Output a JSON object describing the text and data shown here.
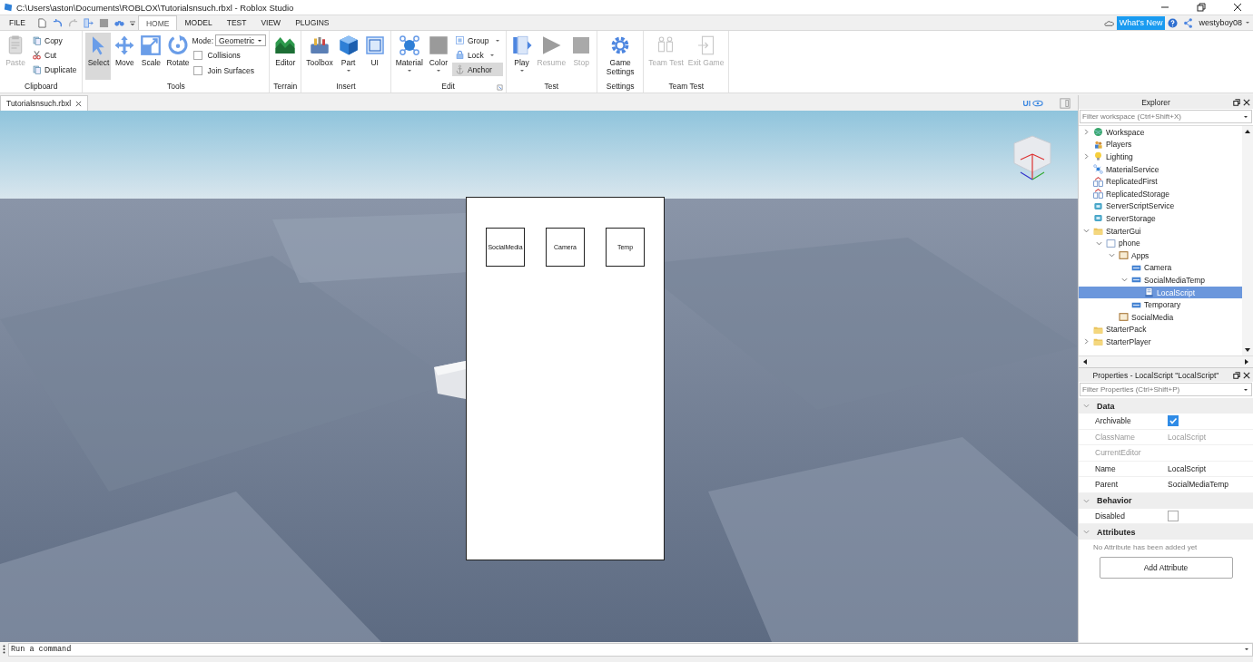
{
  "window": {
    "title": "C:\\Users\\aston\\Documents\\ROBLOX\\Tutorialsnsuch.rbxl - Roblox Studio"
  },
  "file_menu": "FILE",
  "tabs": [
    {
      "label": "HOME",
      "selected": true
    },
    {
      "label": "MODEL",
      "selected": false
    },
    {
      "label": "TEST",
      "selected": false
    },
    {
      "label": "VIEW",
      "selected": false
    },
    {
      "label": "PLUGINS",
      "selected": false
    }
  ],
  "account": {
    "whats_new": "What's New",
    "user": "westyboy08"
  },
  "ribbon": [
    {
      "label": "Clipboard",
      "launcher": false,
      "tools": [
        {
          "kind": "large",
          "label": "Paste",
          "disabled": true,
          "selected": false,
          "menu": false
        },
        {
          "kind": "small",
          "label": "Copy",
          "disabled": false,
          "selected": false,
          "menu": false
        },
        {
          "kind": "small",
          "label": "Cut",
          "disabled": false,
          "selected": false,
          "menu": false
        },
        {
          "kind": "small",
          "label": "Duplicate",
          "disabled": false,
          "selected": false,
          "menu": false
        }
      ]
    },
    {
      "label": "Tools",
      "launcher": false,
      "tools": [
        {
          "kind": "large",
          "label": "Select",
          "disabled": false,
          "selected": true,
          "menu": false
        },
        {
          "kind": "large",
          "label": "Move",
          "disabled": false,
          "selected": false,
          "menu": false
        },
        {
          "kind": "large",
          "label": "Scale",
          "disabled": false,
          "selected": false,
          "menu": false
        },
        {
          "kind": "large",
          "label": "Rotate",
          "disabled": false,
          "selected": false,
          "menu": false
        },
        {
          "kind": "dropdown",
          "label": "Mode:",
          "value": "Geometric"
        },
        {
          "kind": "check",
          "label": "Collisions",
          "checked": false
        },
        {
          "kind": "check",
          "label": "Join Surfaces",
          "checked": false
        }
      ]
    },
    {
      "label": "Terrain",
      "launcher": false,
      "tools": [
        {
          "kind": "large",
          "label": "Editor",
          "disabled": false,
          "selected": false,
          "menu": false
        }
      ]
    },
    {
      "label": "Insert",
      "launcher": false,
      "tools": [
        {
          "kind": "large",
          "label": "Toolbox",
          "disabled": false,
          "selected": false,
          "menu": false
        },
        {
          "kind": "large",
          "label": "Part",
          "disabled": false,
          "selected": false,
          "menu": true
        },
        {
          "kind": "large",
          "label": "UI",
          "disabled": false,
          "selected": false,
          "menu": false
        }
      ]
    },
    {
      "label": "Edit",
      "launcher": true,
      "tools": [
        {
          "kind": "large",
          "label": "Material",
          "disabled": false,
          "selected": false,
          "menu": true
        },
        {
          "kind": "large",
          "label": "Color",
          "disabled": false,
          "selected": false,
          "menu": true
        },
        {
          "kind": "small",
          "label": "Group",
          "disabled": false,
          "selected": false,
          "menu": true
        },
        {
          "kind": "small",
          "label": "Lock",
          "disabled": false,
          "selected": false,
          "menu": true
        },
        {
          "kind": "small",
          "label": "Anchor",
          "disabled": false,
          "selected": true,
          "menu": false
        }
      ]
    },
    {
      "label": "Test",
      "launcher": false,
      "tools": [
        {
          "kind": "large",
          "label": "Play",
          "disabled": false,
          "selected": false,
          "menu": true
        },
        {
          "kind": "large",
          "label": "Resume",
          "disabled": true,
          "selected": false,
          "menu": false
        },
        {
          "kind": "large",
          "label": "Stop",
          "disabled": true,
          "selected": false,
          "menu": false
        }
      ]
    },
    {
      "label": "Settings",
      "launcher": false,
      "tools": [
        {
          "kind": "large",
          "label": "Game Settings",
          "disabled": false,
          "selected": false,
          "menu": false
        }
      ]
    },
    {
      "label": "Team Test",
      "launcher": false,
      "tools": [
        {
          "kind": "large",
          "label": "Team Test",
          "disabled": true,
          "selected": false,
          "menu": false
        },
        {
          "kind": "large",
          "label": "Exit Game",
          "disabled": true,
          "selected": false,
          "menu": false
        }
      ]
    }
  ],
  "document_tab": {
    "label": "Tutorialsnsuch.rbxl"
  },
  "view_toggle": {
    "label": "UI",
    "on": true
  },
  "viewport": {
    "gui": {
      "buttons": [
        "SocialMedia",
        "Camera",
        "Temp"
      ]
    }
  },
  "explorer": {
    "title": "Explorer",
    "filter_placeholder": "Filter workspace (Ctrl+Shift+X)",
    "items": [
      {
        "name": "Workspace",
        "kind": "globe",
        "expanded": false,
        "selected": false
      },
      {
        "name": "Players",
        "kind": "players",
        "selected": false
      },
      {
        "name": "Lighting",
        "kind": "bulb",
        "expanded": false,
        "selected": false
      },
      {
        "name": "MaterialService",
        "kind": "material",
        "selected": false
      },
      {
        "name": "ReplicatedFirst",
        "kind": "replicated",
        "selected": false
      },
      {
        "name": "ReplicatedStorage",
        "kind": "replicated",
        "selected": false
      },
      {
        "name": "ServerScriptService",
        "kind": "server",
        "selected": false
      },
      {
        "name": "ServerStorage",
        "kind": "server",
        "selected": false
      },
      {
        "name": "StarterGui",
        "kind": "folder",
        "expanded": true,
        "selected": false,
        "children": [
          {
            "name": "phone",
            "kind": "screen",
            "expanded": true,
            "selected": false,
            "children": [
              {
                "name": "Apps",
                "kind": "frame",
                "expanded": true,
                "selected": false,
                "children": [
                  {
                    "name": "Camera",
                    "kind": "button",
                    "selected": false
                  },
                  {
                    "name": "SocialMediaTemp",
                    "kind": "button",
                    "expanded": true,
                    "selected": false,
                    "children": [
                      {
                        "name": "LocalScript",
                        "kind": "script",
                        "selected": true
                      }
                    ]
                  },
                  {
                    "name": "Temporary",
                    "kind": "button",
                    "selected": false
                  }
                ]
              },
              {
                "name": "SocialMedia",
                "kind": "frame",
                "selected": false
              }
            ]
          }
        ]
      },
      {
        "name": "StarterPack",
        "kind": "folder",
        "selected": false
      },
      {
        "name": "StarterPlayer",
        "kind": "folder",
        "expanded": false,
        "selected": false
      }
    ]
  },
  "properties": {
    "title": "Properties - LocalScript \"LocalScript\"",
    "filter_placeholder": "Filter Properties (Ctrl+Shift+P)",
    "sections": [
      {
        "title": "Data",
        "expanded": true,
        "rows": [
          {
            "name": "Archivable",
            "kind": "check",
            "checked": true,
            "disabled": false
          },
          {
            "name": "ClassName",
            "kind": "text",
            "value": "LocalScript",
            "disabled": true
          },
          {
            "name": "CurrentEditor",
            "kind": "text",
            "disabled": true
          },
          {
            "name": "Name",
            "kind": "text",
            "value": "LocalScript",
            "disabled": false
          },
          {
            "name": "Parent",
            "kind": "text",
            "value": "SocialMediaTemp",
            "disabled": false
          }
        ]
      },
      {
        "title": "Behavior",
        "expanded": true,
        "rows": [
          {
            "name": "Disabled",
            "kind": "check",
            "checked": false,
            "disabled": false
          }
        ]
      },
      {
        "title": "Attributes",
        "expanded": true,
        "note": "No Attribute has been added yet",
        "button": "Add Attribute"
      }
    ]
  },
  "command_bar": {
    "placeholder": "Run a command"
  }
}
